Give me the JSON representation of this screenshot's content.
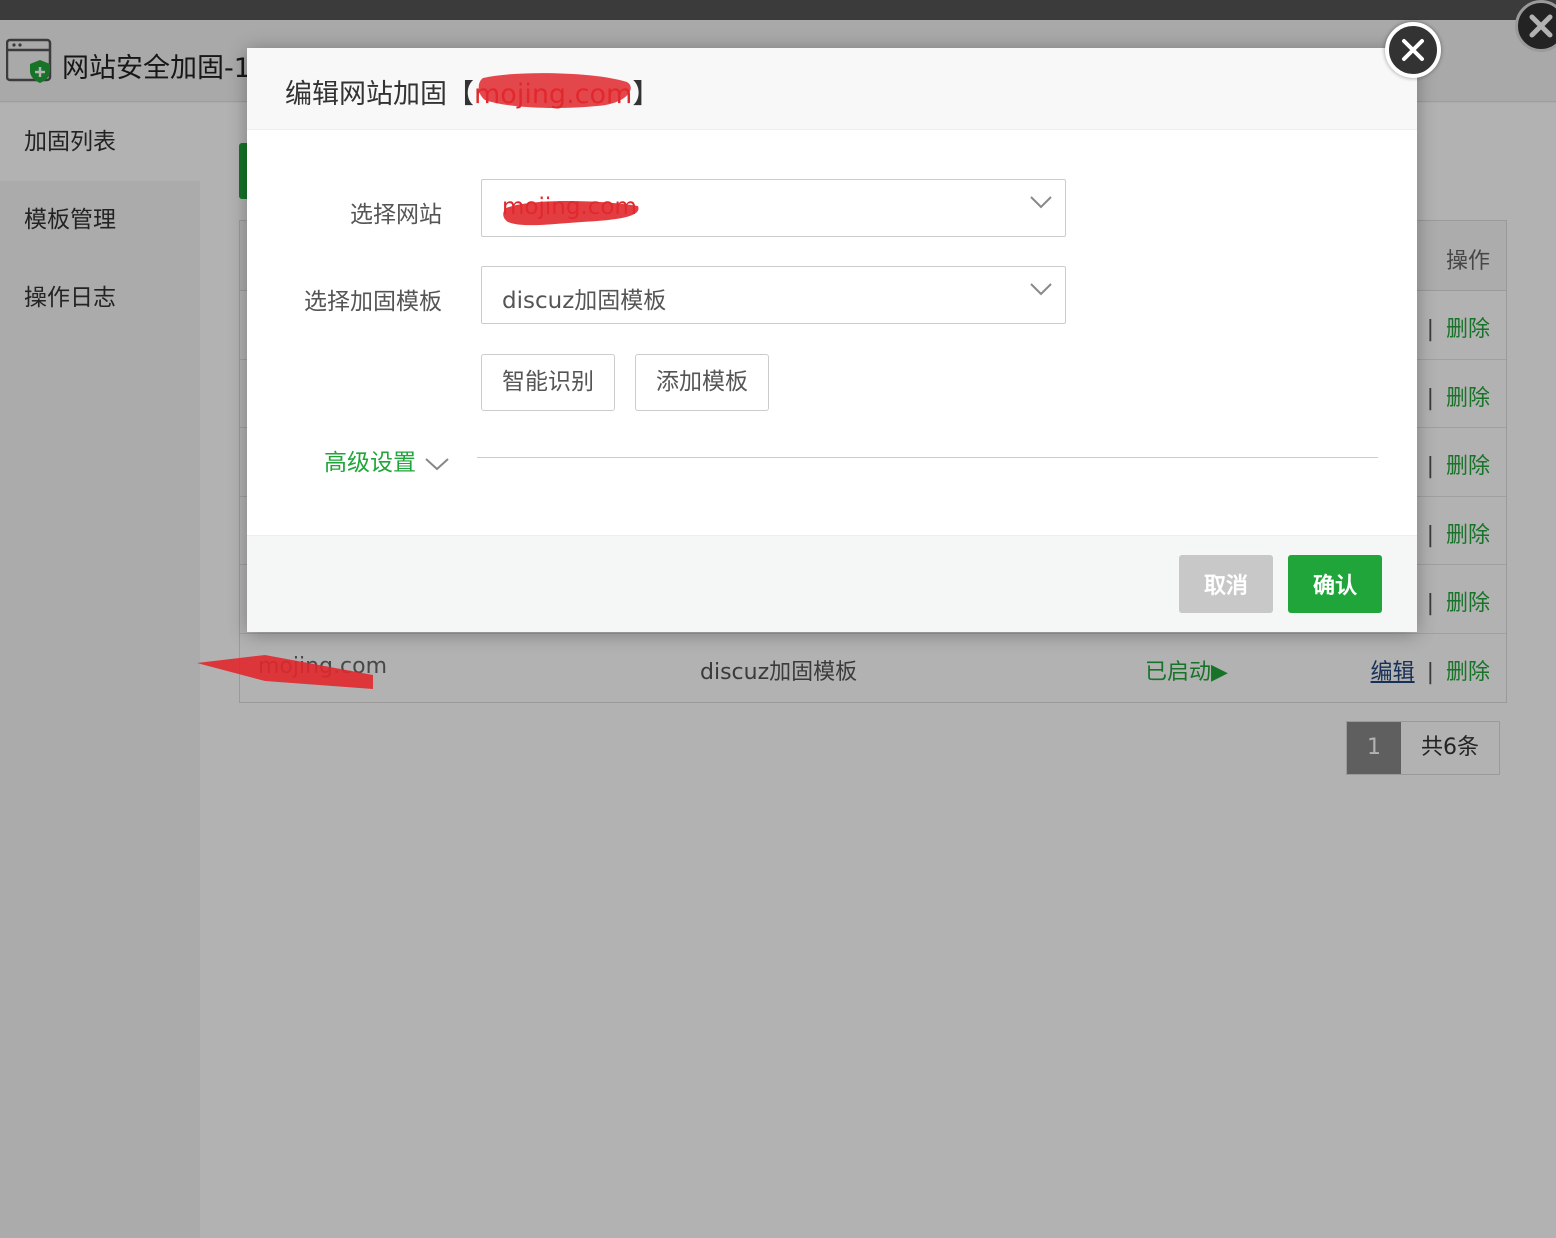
{
  "app": {
    "title": "网站安全加固-1"
  },
  "sidebar": {
    "items": [
      {
        "label": "加固列表",
        "active": true
      },
      {
        "label": "模板管理",
        "active": false
      },
      {
        "label": "操作日志",
        "active": false
      }
    ]
  },
  "table": {
    "op_header": "操作",
    "rows": [
      {
        "ops_sep": "|",
        "delete_label": "删除"
      },
      {
        "ops_sep": "|",
        "delete_label": "删除"
      },
      {
        "ops_sep": "|",
        "delete_label": "删除"
      },
      {
        "ops_sep": "|",
        "delete_label": "删除"
      },
      {
        "ops_sep": "|",
        "delete_label": "删除"
      },
      {
        "site": "mojing.com",
        "template": "discuz加固模板",
        "status": "已启动▶",
        "edit_label": "编辑",
        "ops_sep": "|",
        "delete_label": "删除"
      }
    ]
  },
  "pagination": {
    "current_page": "1",
    "total": "共6条"
  },
  "modal": {
    "title_prefix": "编辑网站加固【",
    "title_site": "mojing.com",
    "title_suffix": "】",
    "site_label": "选择网站",
    "site_value": "mojing.com",
    "template_label": "选择加固模板",
    "template_value": "discuz加固模板",
    "smart_detect_label": "智能识别",
    "add_template_label": "添加模板",
    "advanced_label": "高级设置",
    "cancel_label": "取消",
    "confirm_label": "确认"
  },
  "colors": {
    "accent_green": "#20a53a",
    "link_blue": "#22467d",
    "redaction_red": "#e0282d"
  }
}
